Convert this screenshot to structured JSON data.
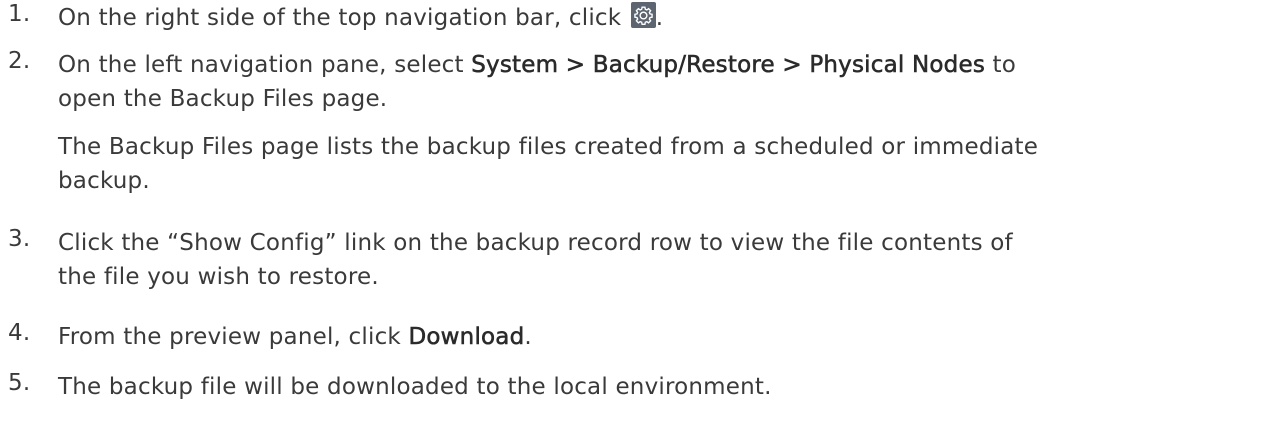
{
  "steps": [
    {
      "number": "1.",
      "line1": "On the right side of the top navigation bar, click ",
      "line1_end": ".",
      "icon": "gear-settings-icon"
    },
    {
      "number": "2.",
      "line1_before": "On the left navigation pane, select ",
      "line1_bold": "System > Backup/Restore > Physical Nodes",
      "line1_after": " to",
      "line2": "open the Backup Files page.",
      "note_line1": "The Backup Files page lists the backup files created from a scheduled or immediate",
      "note_line2": "backup."
    },
    {
      "number": "3.",
      "line1": "Click the “Show Config” link on the backup record row to view the file contents of",
      "line2": "the file you wish to restore."
    },
    {
      "number": "4.",
      "line1_before": "From the preview panel, click ",
      "line1_bold": "Download",
      "line1_after": "."
    },
    {
      "number": "5.",
      "line1": "The backup file will be downloaded to the local environment."
    }
  ],
  "colors": {
    "text": "#3a3a3a",
    "icon_background": "#5c6570",
    "icon_foreground": "#ffffff"
  }
}
